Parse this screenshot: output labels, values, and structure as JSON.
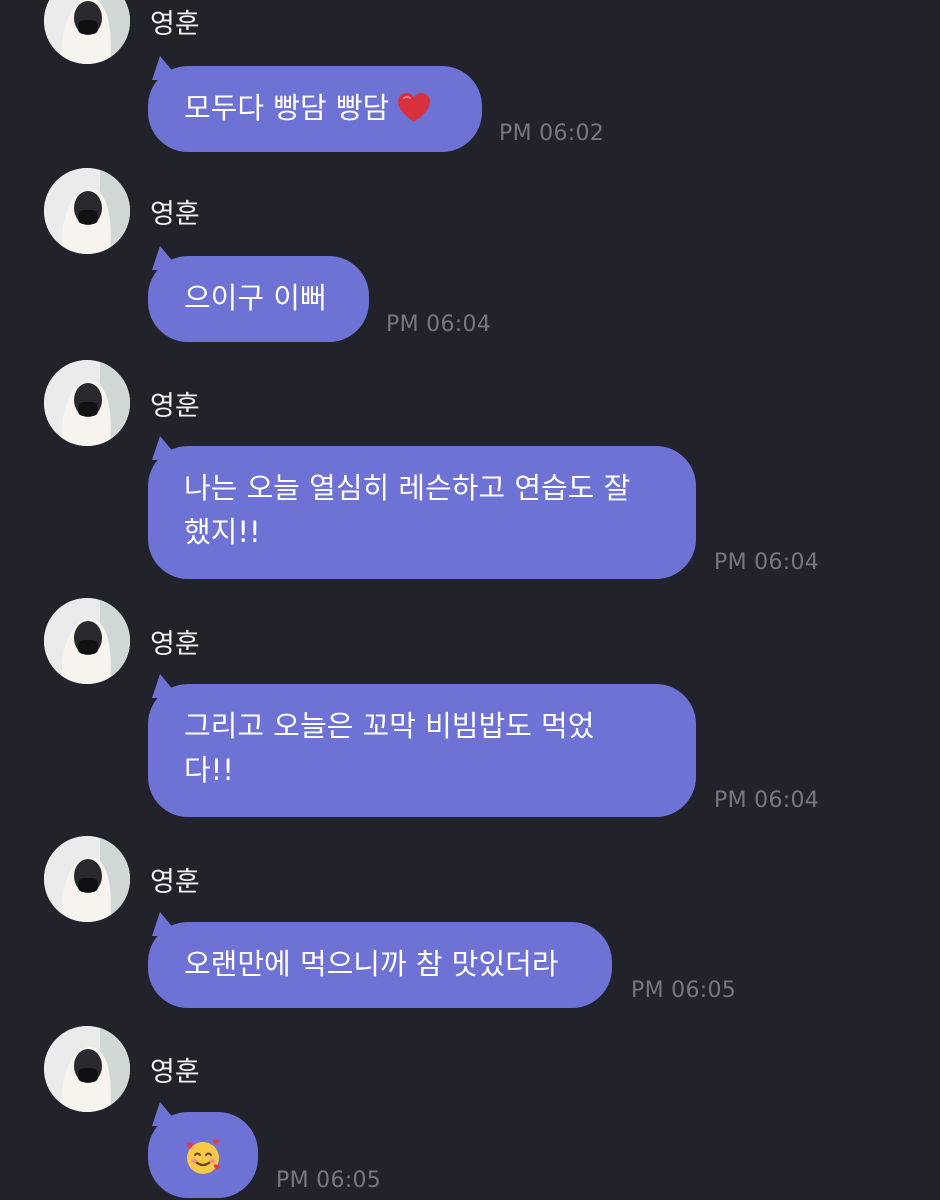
{
  "chat": {
    "messages": [
      {
        "sender": "영훈",
        "text": "모두다 빵담 빵담",
        "emoji": "heart-icon",
        "time": "PM 06:02"
      },
      {
        "sender": "영훈",
        "text": "으이구 이뻐",
        "time": "PM 06:04"
      },
      {
        "sender": "영훈",
        "text": "나는 오늘 열심히 레슨하고 연습도 잘\n했지!!",
        "time": "PM 06:04"
      },
      {
        "sender": "영훈",
        "text": "그리고 오늘은 꼬막 비빔밥도 먹었\n다!!",
        "time": "PM 06:04"
      },
      {
        "sender": "영훈",
        "text": "오랜만에 먹으니까 참 맛있더라",
        "time": "PM 06:05"
      },
      {
        "sender": "영훈",
        "text": "",
        "emoji": "smiling-face-with-hearts-icon",
        "time": "PM 06:05"
      }
    ]
  },
  "theme": {
    "background": "#22222b",
    "bubble": "#6e72d4",
    "sender_text": "#f1f1f4",
    "time_text": "#77777f"
  }
}
